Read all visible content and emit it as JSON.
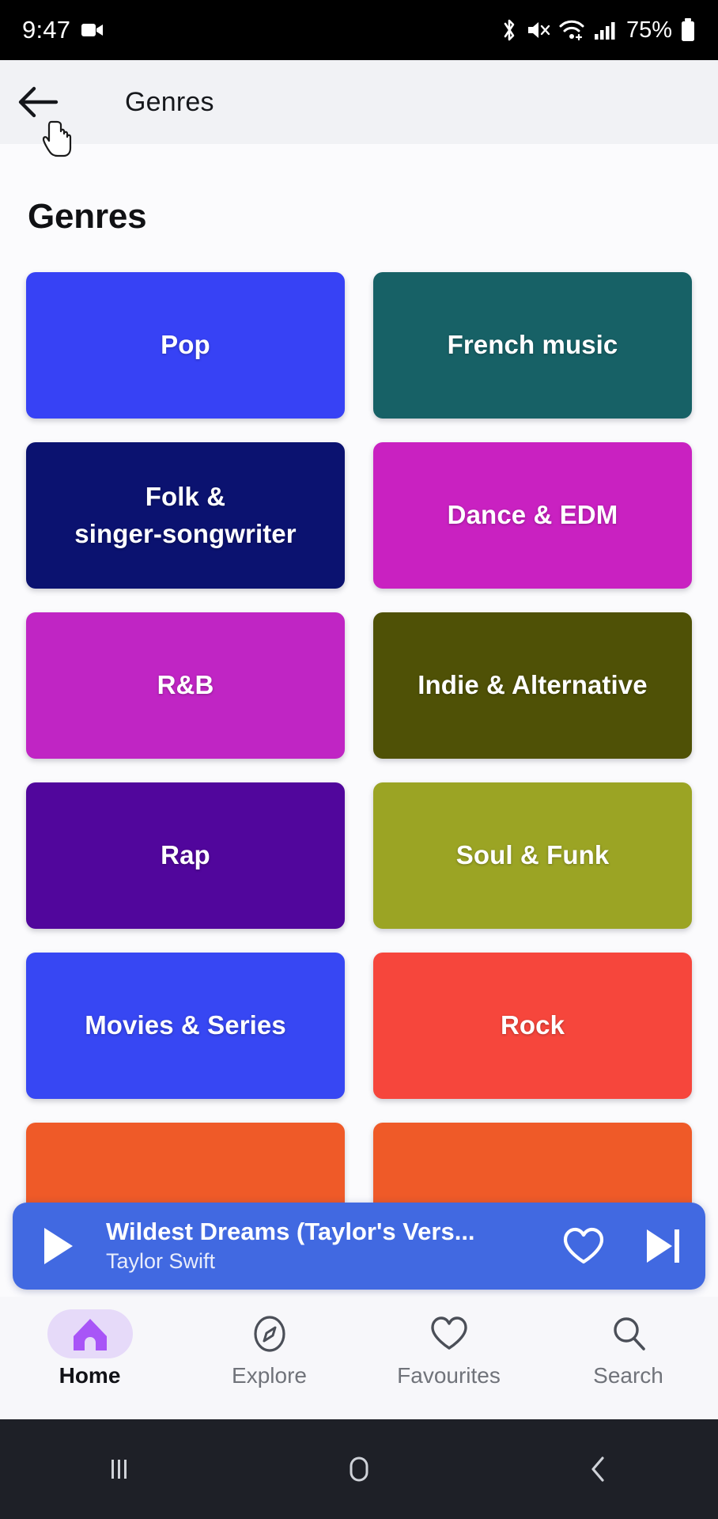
{
  "status_bar": {
    "time": "9:47",
    "battery_percent": "75%",
    "icons": [
      "video-camera-icon",
      "bluetooth-icon",
      "mute-icon",
      "wifi-icon",
      "cellular-signal-icon",
      "battery-icon"
    ]
  },
  "appbar": {
    "title": "Genres",
    "back_icon": "back-arrow-icon"
  },
  "main": {
    "page_title": "Genres",
    "tiles": [
      {
        "label": "Pop",
        "color": "#3742f5"
      },
      {
        "label": "French music",
        "color": "#176166"
      },
      {
        "label": "Folk &\nsinger-songwriter",
        "color": "#0b1270"
      },
      {
        "label": "Dance & EDM",
        "color": "#c921c1"
      },
      {
        "label": "R&B",
        "color": "#c025c4"
      },
      {
        "label": "Indie & Alternative",
        "color": "#4f5106"
      },
      {
        "label": "Rap",
        "color": "#51069c"
      },
      {
        "label": "Soul & Funk",
        "color": "#9ba424"
      },
      {
        "label": "Movies & Series",
        "color": "#3747f3"
      },
      {
        "label": "Rock",
        "color": "#f6463c"
      },
      {
        "label": "",
        "color": "#ef5a28"
      },
      {
        "label": "",
        "color": "#ef5a28"
      }
    ]
  },
  "now_playing": {
    "track_title": "Wildest Dreams (Taylor's Vers...",
    "artist": "Taylor Swift",
    "background_color": "#4169e1",
    "play_icon": "play-icon",
    "favourite_icon": "heart-outline-icon",
    "next_icon": "skip-next-icon"
  },
  "bottom_nav": {
    "items": [
      {
        "label": "Home",
        "icon": "home-icon",
        "active": true
      },
      {
        "label": "Explore",
        "icon": "compass-icon",
        "active": false
      },
      {
        "label": "Favourites",
        "icon": "heart-icon",
        "active": false
      },
      {
        "label": "Search",
        "icon": "search-icon",
        "active": false
      }
    ],
    "active_pill_color": "#e6daf9",
    "active_icon_color": "#a855f7"
  },
  "android_nav": {
    "recents_icon": "recents-icon",
    "home_icon": "home-circle-icon",
    "back_icon": "back-chevron-icon"
  }
}
